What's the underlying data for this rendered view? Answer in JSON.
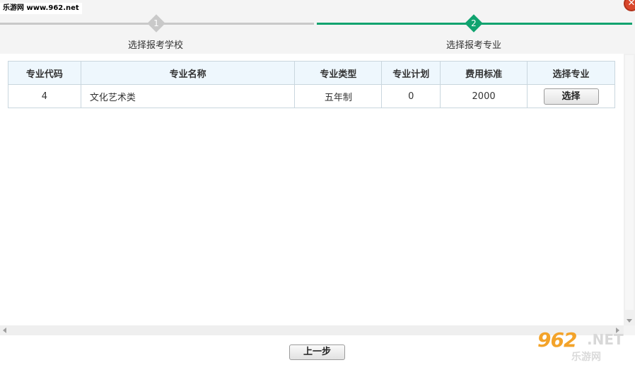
{
  "watermark": {
    "top_text": "乐游网 www.962.net"
  },
  "close": {
    "symbol": "✕"
  },
  "steps": [
    {
      "number": "1",
      "label": "选择报考学校",
      "state": "done"
    },
    {
      "number": "2",
      "label": "选择报考专业",
      "state": "active"
    }
  ],
  "colors": {
    "active_step": "#10a36f",
    "inactive_step": "#c9c9c9",
    "header_bg": "#eef7fd"
  },
  "table": {
    "headers": [
      "专业代码",
      "专业名称",
      "专业类型",
      "专业计划",
      "费用标准",
      "选择专业"
    ],
    "rows": [
      {
        "code": "4",
        "name": "文化艺术类",
        "type": "五年制",
        "plan": "0",
        "fee": "2000",
        "action": "选择"
      }
    ]
  },
  "footer": {
    "prev_label": "上一步"
  },
  "logo": {
    "num": "962",
    "net": ".NET",
    "sub": "乐游网"
  }
}
